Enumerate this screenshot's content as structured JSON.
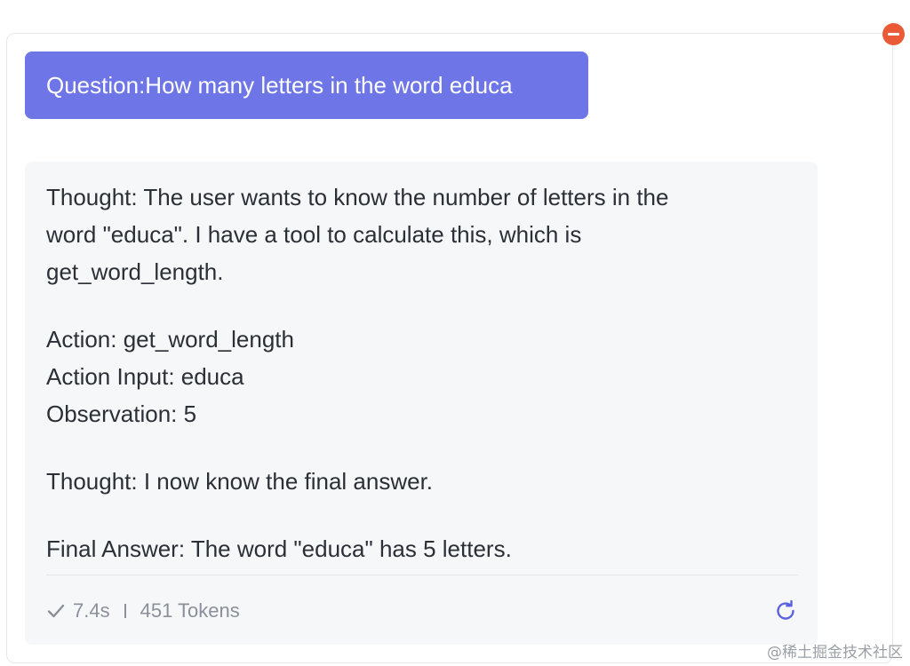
{
  "question": {
    "text": "Question:How many letters in the word educa"
  },
  "answer": {
    "paragraphs": [
      [
        "Thought: The user wants to know the number of letters in the",
        "word \"educa\". I have a tool to calculate this, which is",
        "get_word_length."
      ],
      [
        "Action: get_word_length",
        "Action Input: educa",
        "Observation: 5"
      ],
      [
        "Thought: I now know the final answer."
      ],
      [
        "Final Answer: The word \"educa\" has 5 letters."
      ]
    ]
  },
  "meta": {
    "status_icon": "check-icon",
    "duration": "7.4s",
    "tokens": "451 Tokens",
    "refresh_icon": "refresh-icon"
  },
  "controls": {
    "remove_icon": "minus-circle-icon"
  },
  "colors": {
    "question_bg": "#6e75e6",
    "answer_bg": "#f6f7f9",
    "remove_btn": "#ea5a37",
    "refresh": "#5b62e0",
    "meta_text": "#8a8f99"
  },
  "watermark": "@稀土掘金技术社区"
}
